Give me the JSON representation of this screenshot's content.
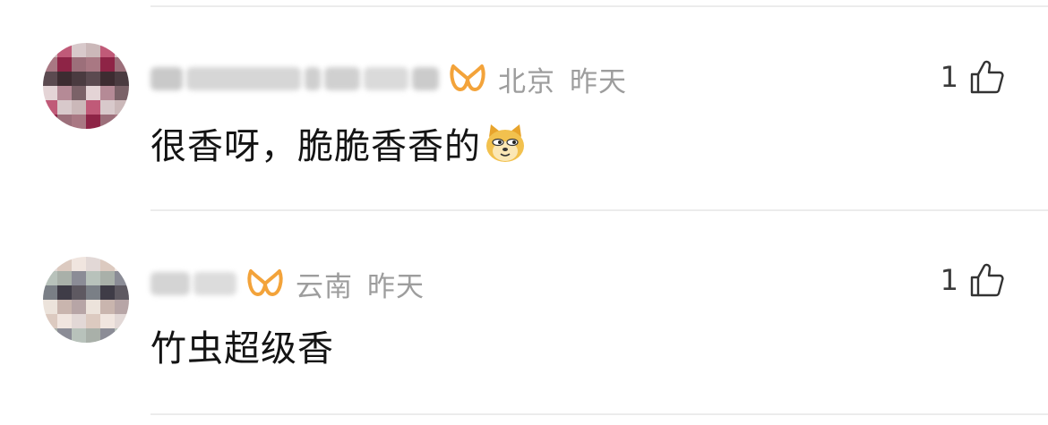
{
  "comments": [
    {
      "location": "北京",
      "time": "昨天",
      "text": "很香呀，脆脆香香的",
      "emoji": "doge-emoji",
      "likes": "1",
      "avatar_colors": [
        "#cbb8b9",
        "#7b6268",
        "#4a3b40",
        "#9c6f7a",
        "#d8c9cb",
        "#b58a96",
        "#3d2c31",
        "#8e2446",
        "#c05a78",
        "#e4d4d6",
        "#5b4a50",
        "#a97883"
      ]
    },
    {
      "location": "云南",
      "time": "昨天",
      "text": "竹虫超级香",
      "likes": "1",
      "avatar_colors": [
        "#e2d8d6",
        "#b7a5a6",
        "#5e5961",
        "#8b8c96",
        "#f0e5df",
        "#c9b5ae",
        "#3f3c47",
        "#a9b0a9",
        "#dccac0",
        "#ece3db",
        "#7a7f86",
        "#b8c2bb"
      ]
    }
  ],
  "icons": {
    "vip": "vip-badge-icon",
    "like": "thumb-up-icon"
  },
  "colors": {
    "vip": "#f3a33a",
    "meta_text": "#9d9d9d",
    "body_text": "#141414"
  }
}
